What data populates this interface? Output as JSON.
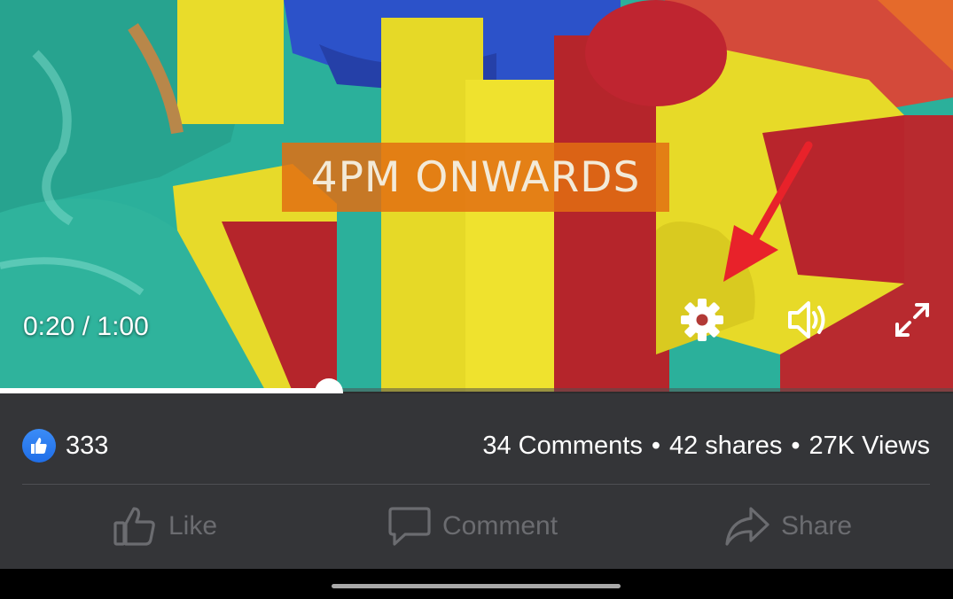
{
  "video": {
    "overlay_text": "4PM ONWARDS",
    "time_display": "0:20 / 1:00",
    "progress_fraction": 0.345
  },
  "reactions": {
    "like_count": "333",
    "comments": "34 Comments",
    "shares": "42 shares",
    "views": "27K Views",
    "separator": "•"
  },
  "actions": {
    "like_label": "Like",
    "comment_label": "Comment",
    "share_label": "Share"
  },
  "annotation": {
    "arrow_color": "#e8222a"
  },
  "icons": [
    "settings-gear-icon",
    "volume-icon",
    "fullscreen-icon",
    "thumbs-up-icon",
    "comment-icon",
    "share-icon"
  ]
}
